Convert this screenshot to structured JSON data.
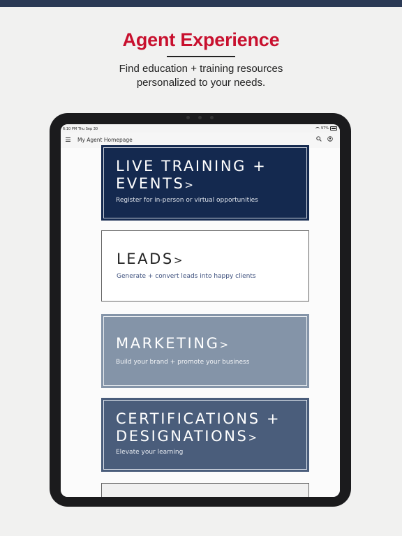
{
  "promo": {
    "headline": "Agent Experience",
    "subtitle_line1": "Find education + training resources",
    "subtitle_line2": "personalized to your needs."
  },
  "statusbar": {
    "time": "6:10 PM  Thu Sep 30",
    "battery": "97%"
  },
  "appbar": {
    "title": "My Agent Homepage",
    "menu_icon": "hamburger-menu-icon",
    "search_icon": "search-icon",
    "profile_icon": "profile-icon"
  },
  "cards": [
    {
      "title_line1": "LIVE TRAINING +",
      "title_line2": "EVENTS",
      "arrow": ">",
      "description": "Register for in-person or virtual opportunities",
      "color": "#14294f"
    },
    {
      "title_line1": "LEADS",
      "arrow": ">",
      "description": "Generate + convert leads into happy clients",
      "color": "#ffffff"
    },
    {
      "title_line1": "MARKETING",
      "arrow": ">",
      "description": "Build your brand + promote your business",
      "color": "#8494a8"
    },
    {
      "title_line1": "CERTIFICATIONS +",
      "title_line2": "DESIGNATIONS",
      "arrow": ">",
      "description": "Elevate your learning",
      "color": "#4a5d7b"
    }
  ],
  "colors": {
    "brand_red": "#c8102e",
    "navy": "#14294f"
  }
}
